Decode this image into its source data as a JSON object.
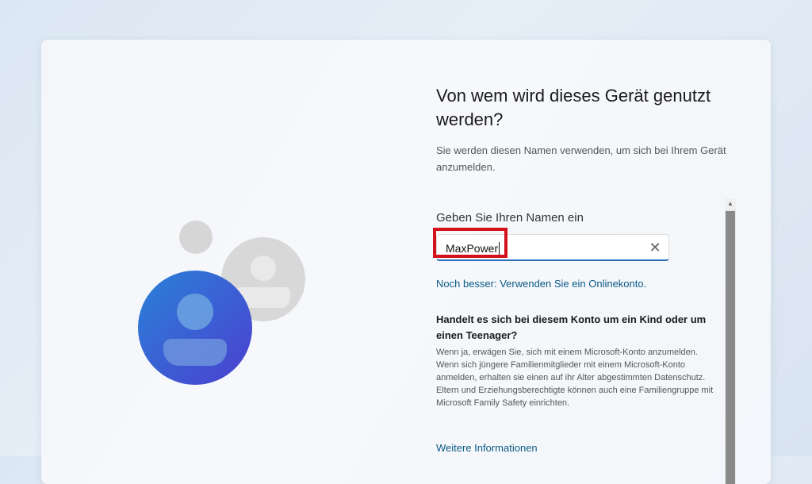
{
  "title": "Von wem wird dieses Gerät genutzt werden?",
  "subtitle": "Sie werden diesen Namen verwenden, um sich bei Ihrem Gerät anzumelden.",
  "name_field": {
    "label": "Geben Sie Ihren Namen ein",
    "value": "MaxPower",
    "clear_icon": "close-icon"
  },
  "online_account_link": "Noch besser: Verwenden Sie ein Onlinekonto.",
  "child_section": {
    "heading": "Handelt es sich bei diesem Konto um ein Kind oder um einen Teenager?",
    "body": "Wenn ja, erwägen Sie, sich mit einem Microsoft-Konto anzumelden. Wenn sich jüngere Familienmitglieder mit einem Microsoft-Konto anmelden, erhalten sie einen auf ihr Alter abgestimmten Datenschutz. Eltern und Erziehungsberechtigte können auch eine Familiengruppe mit Microsoft Family Safety einrichten."
  },
  "more_info_link": "Weitere Informationen",
  "colors": {
    "accent": "#2a6fb8",
    "link": "#0b5a86",
    "highlight": "#d3111a",
    "avatar_primary": "#2f68c9",
    "avatar_secondary": "#d9d9d9"
  }
}
